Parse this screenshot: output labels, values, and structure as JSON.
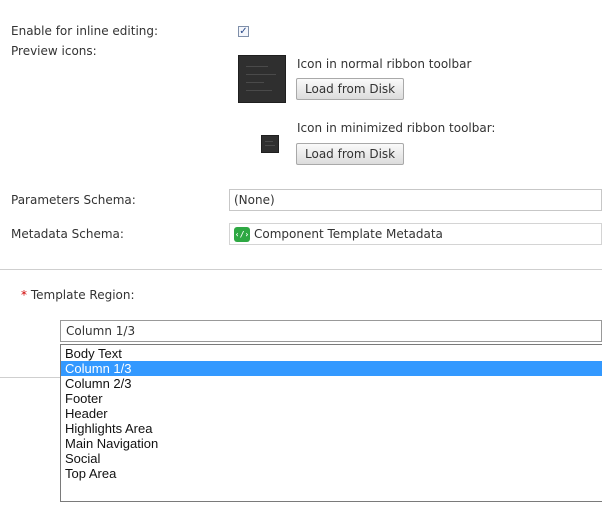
{
  "settings": {
    "inline_editing_label": "Enable for inline editing:",
    "inline_editing_checked": true,
    "check_glyph": "✓",
    "preview_icons_label": "Preview icons:",
    "normal_icon_label": "Icon in normal ribbon toolbar",
    "normal_load_button": "Load from Disk",
    "minimized_icon_label": "Icon in minimized ribbon toolbar:",
    "minimized_load_button": "Load from Disk",
    "parameters_schema_label": "Parameters Schema:",
    "parameters_schema_value": "(None)",
    "metadata_schema_label": "Metadata Schema:",
    "metadata_schema_value": "Component Template Metadata",
    "metadata_schema_icon": "schema-icon",
    "metadata_schema_icon_glyph": "‹/›"
  },
  "region": {
    "required_marker": "*",
    "label": "Template Region:",
    "selected_value": "Column 1/3",
    "options": [
      "Body Text",
      "Column 1/3",
      "Column 2/3",
      "Footer",
      "Header",
      "Highlights Area",
      "Main Navigation",
      "Social",
      "Top Area"
    ],
    "highlighted_index": 1
  },
  "colors": {
    "highlight": "#3399ff",
    "required": "#d00000",
    "schema_icon": "#2ea843"
  }
}
